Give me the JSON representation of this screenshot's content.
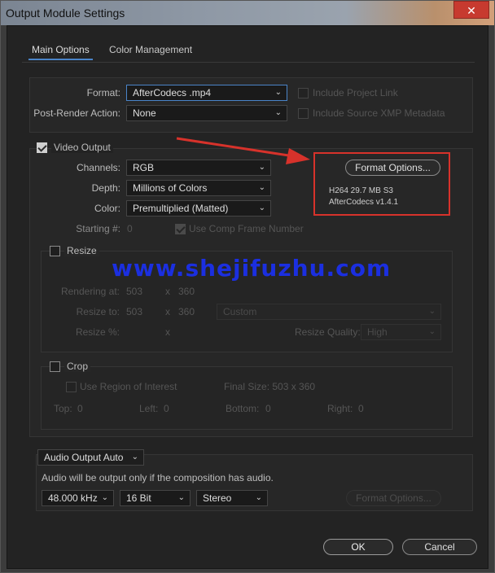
{
  "window": {
    "title": "Output Module Settings",
    "close_glyph": "✕"
  },
  "tabs": [
    {
      "label": "Main Options"
    },
    {
      "label": "Color Management"
    }
  ],
  "main": {
    "format_label": "Format:",
    "format_value": "AfterCodecs .mp4",
    "post_render_label": "Post-Render Action:",
    "post_render_value": "None",
    "include_project_link": "Include Project Link",
    "include_xmp": "Include Source XMP Metadata"
  },
  "video": {
    "section_label": "Video Output",
    "channels_label": "Channels:",
    "channels_value": "RGB",
    "depth_label": "Depth:",
    "depth_value": "Millions of Colors",
    "color_label": "Color:",
    "color_value": "Premultiplied (Matted)",
    "starting_label": "Starting #:",
    "starting_value": "0",
    "use_comp_frame": "Use Comp Frame Number",
    "format_options_button": "Format Options...",
    "info_line1": "H264 29.7 MB S3",
    "info_line2": "AfterCodecs v1.4.1"
  },
  "resize": {
    "label": "Resize",
    "rendering_at_label": "Rendering at:",
    "rendering_w": "503",
    "rendering_h": "360",
    "resize_to_label": "Resize to:",
    "resize_w": "503",
    "resize_h": "360",
    "resize_preset": "Custom",
    "resize_pct_label": "Resize %:",
    "x_sep": "x",
    "quality_label": "Resize Quality:",
    "quality_value": "High"
  },
  "crop": {
    "label": "Crop",
    "use_roi": "Use Region of Interest",
    "final_size": "Final Size: 503 x 360",
    "top_label": "Top:",
    "top_value": "0",
    "left_label": "Left:",
    "left_value": "0",
    "bottom_label": "Bottom:",
    "bottom_value": "0",
    "right_label": "Right:",
    "right_value": "0"
  },
  "audio": {
    "output_value": "Audio Output Auto",
    "note": "Audio will be output only if the composition has audio.",
    "rate": "48.000 kHz",
    "bits": "16 Bit",
    "channels": "Stereo",
    "format_options": "Format Options..."
  },
  "footer": {
    "ok": "OK",
    "cancel": "Cancel"
  },
  "watermark": "www.shejifuzhu.com",
  "colors": {
    "accent": "#4a84c8",
    "annotation_red": "#d7322b",
    "watermark_blue": "#1b2fe0"
  }
}
